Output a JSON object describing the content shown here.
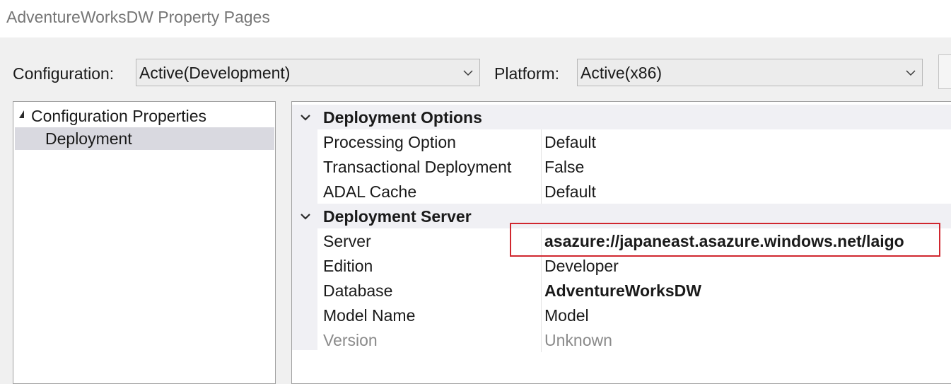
{
  "window": {
    "title": "AdventureWorksDW Property Pages"
  },
  "toolbar": {
    "configuration_label": "Configuration:",
    "configuration_value": "Active(Development)",
    "platform_label": "Platform:",
    "platform_value": "Active(x86)"
  },
  "tree": {
    "root_label": "Configuration Properties",
    "child_label": "Deployment"
  },
  "grid": {
    "categories": [
      {
        "label": "Deployment Options",
        "properties": [
          {
            "name": "Processing Option",
            "value": "Default"
          },
          {
            "name": "Transactional Deployment",
            "value": "False"
          },
          {
            "name": "ADAL Cache",
            "value": "Default"
          }
        ]
      },
      {
        "label": "Deployment Server",
        "properties": [
          {
            "name": "Server",
            "value": "asazure://japaneast.asazure.windows.net/laigo"
          },
          {
            "name": "Edition",
            "value": "Developer"
          },
          {
            "name": "Database",
            "value": "AdventureWorksDW"
          },
          {
            "name": "Model Name",
            "value": "Model"
          },
          {
            "name": "Version",
            "value": "Unknown"
          }
        ]
      }
    ]
  },
  "colors": {
    "highlight_border": "#d0272f",
    "selection": "#d9d9e0"
  },
  "icons": {
    "combo_dropdown": "chevron-down-icon",
    "tree_expand": "triangle-expanded-icon",
    "category_expand": "chevron-down-icon"
  }
}
